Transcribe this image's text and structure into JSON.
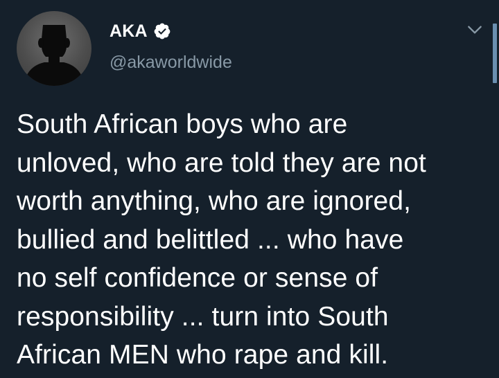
{
  "author": {
    "display_name": "AKA",
    "handle": "@akaworldwide",
    "verified": true
  },
  "tweet": {
    "lines": [
      "South African boys who are",
      "unloved, who are told they are not",
      "worth anything, who are ignored,",
      "bullied and belittled ... who have",
      "no self confidence or sense of",
      "responsibility ... turn into South",
      "African MEN who rape and kill."
    ]
  },
  "icons": {
    "verified": "verified-badge-icon",
    "menu": "chevron-down-icon"
  },
  "colors": {
    "background": "#15202b",
    "text_primary": "#ffffff",
    "text_secondary": "#8899a6",
    "scrollbar": "#6b8fb0"
  }
}
